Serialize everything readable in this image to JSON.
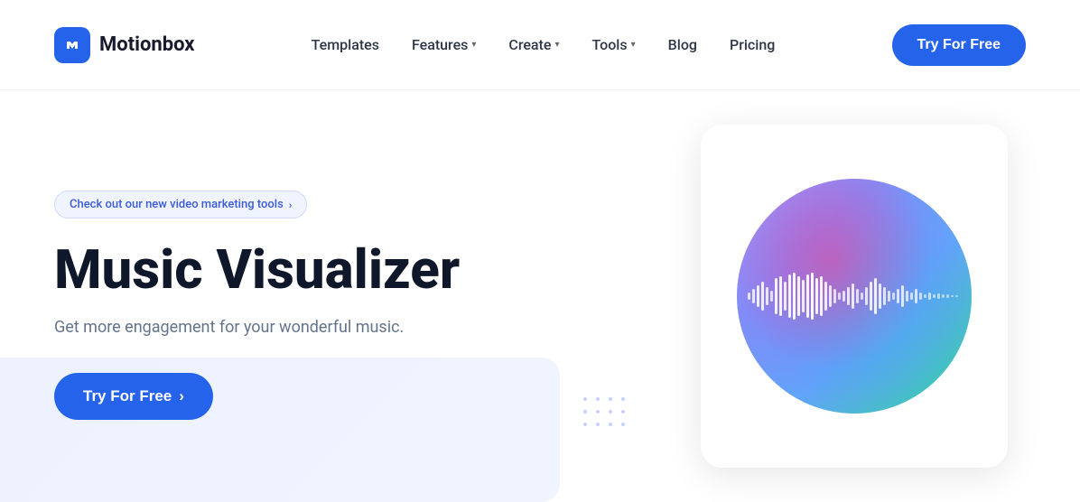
{
  "header": {
    "logo_icon": "M",
    "logo_text": "Motionbox",
    "nav": {
      "items": [
        {
          "label": "Templates",
          "hasDropdown": false
        },
        {
          "label": "Features",
          "hasDropdown": true
        },
        {
          "label": "Create",
          "hasDropdown": true
        },
        {
          "label": "Tools",
          "hasDropdown": true
        },
        {
          "label": "Blog",
          "hasDropdown": false
        },
        {
          "label": "Pricing",
          "hasDropdown": false
        }
      ]
    },
    "cta_label": "Try For Free"
  },
  "hero": {
    "badge_text": "Check out our new video marketing tools",
    "badge_arrow": "›",
    "title": "Music Visualizer",
    "subtitle": "Get more engagement for your wonderful music.",
    "cta_label": "Try For Free",
    "cta_arrow": "›"
  }
}
